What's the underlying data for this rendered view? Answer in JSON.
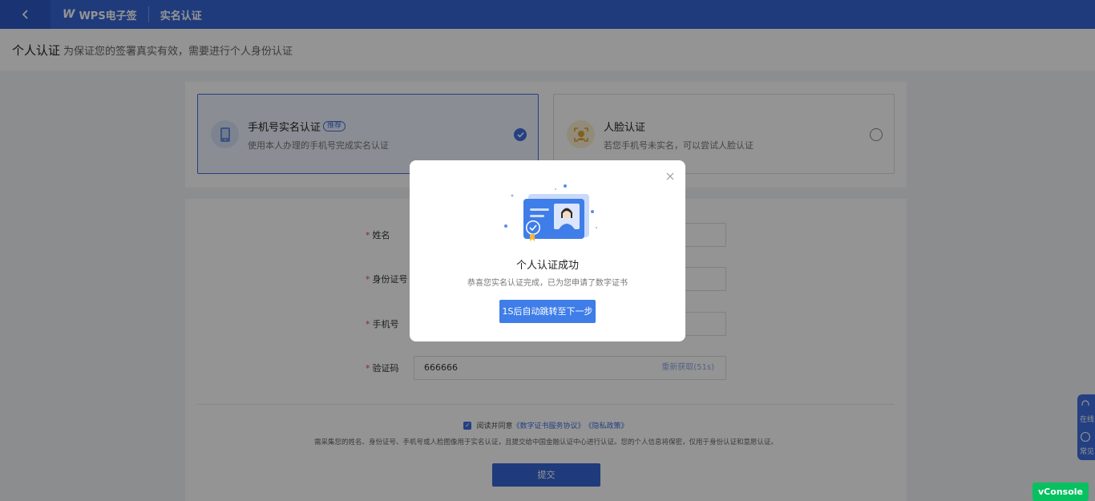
{
  "nav": {
    "back_icon": "chevron-left-icon",
    "brand_logo": "W",
    "brand_name": "WPS电子签",
    "title": "实名认证"
  },
  "header": {
    "title": "个人认证",
    "subtitle": "为保证您的签署真实有效，需要进行个人身份认证"
  },
  "methods": [
    {
      "title": "手机号实名认证",
      "tag": "推荐",
      "desc": "使用本人办理的手机号完成实名认证",
      "selected": true,
      "icon": "phone-icon"
    },
    {
      "title": "人脸认证",
      "tag": "",
      "desc": "若您手机号未实名，可以尝试人脸认证",
      "selected": false,
      "icon": "face-icon"
    }
  ],
  "form": {
    "name_label": "姓名",
    "name_value": "",
    "id_label": "身份证号",
    "id_value": "",
    "phone_label": "手机号",
    "phone_value": "",
    "code_label": "验证码",
    "code_value": "666666",
    "resend_label": "重新获取(51s)",
    "required_mark": "*"
  },
  "agreement": {
    "checked": true,
    "prefix": "阅读并同意",
    "link1": "《数字证书服务协议》",
    "link2": "《隐私政策》",
    "notice": "需采集您的姓名、身份证号、手机号或人脸图像用于实名认证，且提交给中国金融认证中心进行认证。您的个人信息将保密，仅用于身份认证和意愿认证。"
  },
  "submit_label": "提交",
  "floating_help": {
    "item1": "在线",
    "item2": "常见"
  },
  "vconsole_label": "vConsole",
  "modal": {
    "close_icon": "close-icon",
    "illustration": "id-card-certificate-illustration",
    "title": "个人认证成功",
    "desc": "恭喜您实名认证完成，已为您申请了数字证书",
    "button": "1S后自动跳转至下一步"
  },
  "colors": {
    "primary": "#3666d6",
    "accent": "#3f6fe0",
    "vconsole": "#07c160",
    "required": "#e34d4d"
  }
}
